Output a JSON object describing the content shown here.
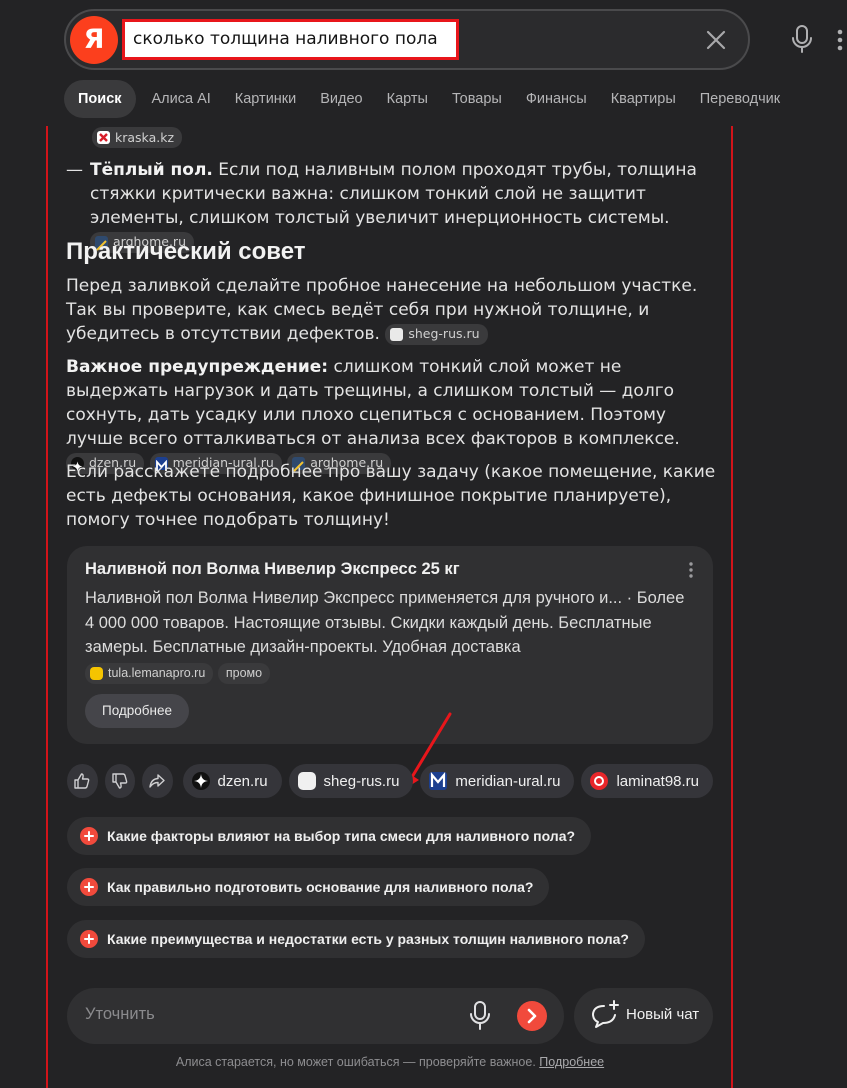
{
  "search": {
    "query": "сколько толщина наливного пола",
    "logo_letter": "Я"
  },
  "tabs": [
    {
      "label": "Поиск",
      "active": true
    },
    {
      "label": "Алиса AI"
    },
    {
      "label": "Картинки"
    },
    {
      "label": "Видео"
    },
    {
      "label": "Карты"
    },
    {
      "label": "Товары"
    },
    {
      "label": "Финансы"
    },
    {
      "label": "Квартиры"
    },
    {
      "label": "Переводчик"
    }
  ],
  "answer": {
    "top_source": "kraska.kz",
    "warm_floor": {
      "bullet": "—",
      "bold": "Тёплый пол.",
      "text": " Если под наливным полом проходят трубы, толщина стяжки критически важна: слишком тонкий слой не защитит элементы, слишком толстый увеличит инерционность системы.",
      "source": "arghome.ru"
    },
    "advice_heading": "Практический совет",
    "advice_text": "Перед заливкой сделайте пробное нанесение на небольшом участке. Так вы проверите, как смесь ведёт себя при нужной толщине, и убедитесь в отсутствии дефектов.",
    "advice_source": "sheg-rus.ru",
    "warning_bold": "Важное предупреждение:",
    "warning_text": " слишком тонкий слой может не выдержать нагрузок и дать трещины, а слишком толстый — долго сохнуть, дать усадку или плохо сцепиться с основанием. Поэтому лучше всего отталкиваться от анализа всех факторов в комплексе.",
    "warning_sources": [
      "dzen.ru",
      "meridian-ural.ru",
      "arghome.ru"
    ],
    "closing_text": "Если расскажете подробнее про вашу задачу (какое помещение, какие есть дефекты основания, какое финишное покрытие планируете), помогу точнее подобрать толщину!"
  },
  "ad_card": {
    "title": "Наливной пол Волма Нивелир Экспресс 25 кг",
    "text": "Наливной пол Волма Нивелир Экспресс применяется для ручного и... · Более 4 000 000 товаров. Настоящие отзывы. Скидки каждый день. Бесплатные замеры. Бесплатные дизайн-проекты. Удобная доставка",
    "source": "tula.lemanapro.ru",
    "promo_label": "промо",
    "button_label": "Подробнее"
  },
  "source_pills": [
    "dzen.ru",
    "sheg-rus.ru",
    "meridian-ural.ru",
    "laminat98.ru"
  ],
  "suggestions": [
    "Какие факторы влияют на выбор типа смеси для наливного пола?",
    "Как правильно подготовить основание для наливного пола?",
    "Какие преимущества и недостатки есть у разных толщин наливного пола?"
  ],
  "refine": {
    "placeholder": "Уточнить",
    "new_chat_label": "Новый чат"
  },
  "footer": {
    "text": "Алиса старается, но может ошибаться — проверяйте важное.",
    "link": "Подробнее"
  },
  "colors": {
    "background": "#232325",
    "accent": "#f14a3c",
    "yandex_red": "#fc3f1d",
    "annotation_red": "#d2141a"
  },
  "icons": [
    "yandex-logo",
    "clear-icon",
    "mic-icon",
    "more-icon",
    "thumbs-up-icon",
    "thumbs-down-icon",
    "share-icon",
    "plus-circle-icon",
    "send-icon",
    "new-chat-icon"
  ]
}
